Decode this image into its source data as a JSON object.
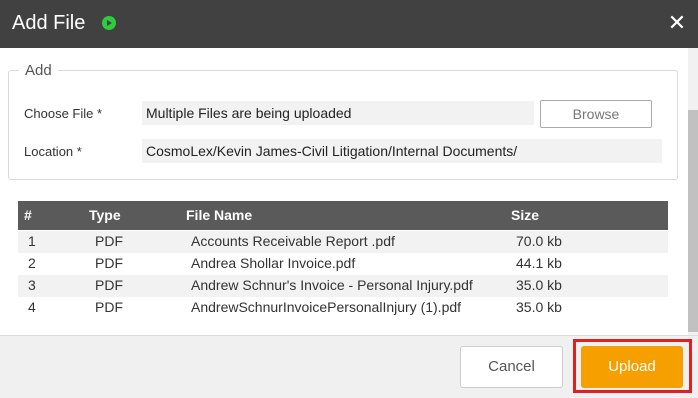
{
  "header": {
    "title": "Add File",
    "play_icon": "play-circle-icon",
    "close_icon": "close-icon",
    "close_glyph": "✕",
    "accent_color": "#2ecc40"
  },
  "add_section": {
    "legend": "Add",
    "choose_file_label": "Choose File *",
    "choose_file_value": "Multiple Files are being uploaded",
    "browse_label": "Browse",
    "location_label": "Location *",
    "location_value": "CosmoLex/Kevin James-Civil Litigation/Internal Documents/"
  },
  "table": {
    "headers": [
      "#",
      "Type",
      "File Name",
      "Size"
    ],
    "rows": [
      {
        "num": "1",
        "type": "PDF",
        "name": "Accounts Receivable Report .pdf",
        "size": "70.0 kb"
      },
      {
        "num": "2",
        "type": "PDF",
        "name": "Andrea Shollar Invoice.pdf",
        "size": "44.1 kb"
      },
      {
        "num": "3",
        "type": "PDF",
        "name": "Andrew Schnur's Invoice - Personal Injury.pdf",
        "size": "35.0 kb"
      },
      {
        "num": "4",
        "type": "PDF",
        "name": "AndrewSchnurInvoicePersonalInjury (1).pdf",
        "size": "35.0 kb"
      }
    ]
  },
  "footer": {
    "cancel_label": "Cancel",
    "upload_label": "Upload",
    "upload_color": "#f5a000",
    "highlight_color": "#e02020"
  }
}
